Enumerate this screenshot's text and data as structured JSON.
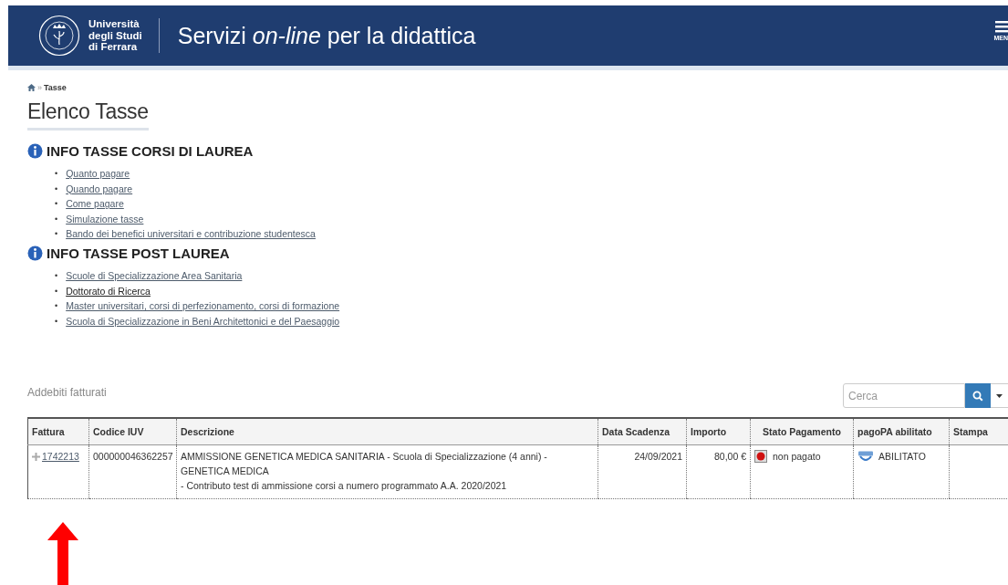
{
  "header": {
    "university_name": [
      "Università",
      "degli Studi",
      "di Ferrara"
    ],
    "title": "Servizi *on-line* per la didattica",
    "menu_label": "MEN"
  },
  "breadcrumb": {
    "separator": "»",
    "current": "Tasse"
  },
  "page_title": "Elenco Tasse",
  "sections": [
    {
      "heading": "INFO TASSE CORSI DI LAUREA",
      "bullet": "•",
      "links": [
        {
          "label": "Quanto pagare",
          "visited": false
        },
        {
          "label": "Quando pagare",
          "visited": false
        },
        {
          "label": "Come pagare",
          "visited": false
        },
        {
          "label": "Simulazione tasse",
          "visited": false
        },
        {
          "label": "Bando dei benefici universitari e contribuzione studentesca",
          "visited": false
        }
      ]
    },
    {
      "heading": "INFO TASSE POST LAUREA",
      "bullet": "•",
      "links": [
        {
          "label": "Scuole di Specializzazione Area Sanitaria",
          "visited": false
        },
        {
          "label": "Dottorato di Ricerca",
          "visited": true
        },
        {
          "label": "Master universitari, corsi di perfezionamento, corsi di formazione",
          "visited": false
        },
        {
          "label": "Scuola di Specializzazione in Beni Architettonici e del Paesaggio",
          "visited": false
        }
      ]
    }
  ],
  "search": {
    "placeholder": "Cerca"
  },
  "table": {
    "caption": "Addebiti fatturati",
    "columns": [
      "Fattura",
      "Codice IUV",
      "Descrizione",
      "Data Scadenza",
      "Importo",
      "Stato Pagamento",
      "pagoPA abilitato",
      "Stampa"
    ],
    "rows": [
      {
        "expanded": false,
        "invoice": "1742213",
        "iuv": "000000046362257",
        "description": [
          "AMMISSIONE GENETICA MEDICA SANITARIA - Scuola di Specializzazione (4 anni) - GENETICA MEDICA",
          "- Contributo test di ammissione corsi a numero programmato A.A. 2020/2021"
        ],
        "due_date": "24/09/2021",
        "amount": "80,00 €",
        "paid": false,
        "status": "non pagato",
        "pagopa": "ABILITATO"
      }
    ]
  }
}
